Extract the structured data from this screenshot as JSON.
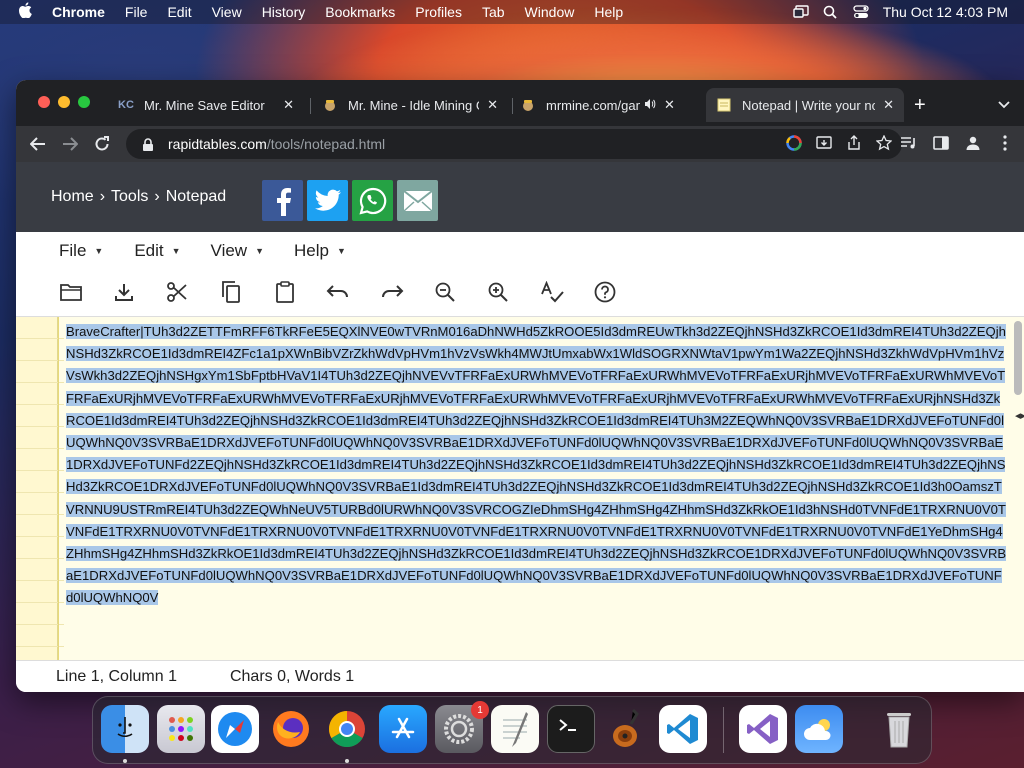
{
  "menubar": {
    "app_name": "Chrome",
    "items": [
      "File",
      "Edit",
      "View",
      "History",
      "Bookmarks",
      "Profiles",
      "Tab",
      "Window",
      "Help"
    ],
    "clock": "Thu Oct 12  4:03 PM"
  },
  "tabs": [
    {
      "title": "Mr. Mine Save Editor",
      "favicon": "KC"
    },
    {
      "title": "Mr. Mine - Idle Mining Game",
      "favicon": "miner"
    },
    {
      "title": "mrmine.com/game/",
      "favicon": "miner"
    },
    {
      "title": "Notepad | Write your notes",
      "favicon": "notepad"
    }
  ],
  "omnibox": {
    "domain": "rapidtables.com",
    "path": "/tools/notepad.html"
  },
  "site": {
    "breadcrumb": [
      "Home",
      "›",
      "Tools",
      "›",
      "Notepad"
    ],
    "share": [
      "f",
      "twitter",
      "whatsapp",
      "email"
    ]
  },
  "app_menu": [
    "File",
    "Edit",
    "View",
    "Help"
  ],
  "toolbar_icons": [
    "open-folder",
    "download",
    "cut",
    "copy",
    "paste",
    "undo",
    "redo",
    "zoom-out",
    "zoom-in",
    "spellcheck",
    "help"
  ],
  "editor": {
    "text": "BraveCrafter|TUh3d2ZETTFmRFF6TkRFeE5EQXlNVE0wTVRnM016aDhNWHd5ZkROOE5Id3dmREUwTkh3d2ZEQjhNSHd3ZkRCOE1Id3dmREI4TUh3d2ZEQjhNSHd3ZkRCOE1Id3dmREI4ZFc1a1pXWnBibVZrZkhWdVpHVm1hVzVsWkh4MWJtUmxabWx1WldSOGRXNWtaV1pwYm1Wa2ZEQjhNSHd3ZkhWdVpHVm1hVzVsWkh3d2ZEQjhNSHgxYm1SbFptbHVaV1I4TUh3d2ZEQjhNVEVvTFRFaExURWhMVEVoTFRFaExURWhMVEVoTFRFaExURjhMVEVoTFRFaExURWhMVEVoTFRFaExURjhMVEVoTFRFaExURWhMVEVoTFRFaExURjhMVEVoTFRFaExURWhMVEVoTFRFaExURjhMVEVoTFRFaExURWhMVEVoTFRFaExURjhNSHd3ZkRCOE1Id3dmREI4TUh3d2ZEQjhNSHd3ZkRCOE1Id3dmREI4TUh3d2ZEQjhNSHd3ZkRCOE1Id3dmREI4TUh3M2ZEQWhNQ0V3SVRBaE1DRXdJVEFoTUNFd0lUQWhNQ0V3SVRBaE1DRXdJVEFoTUNFd0lUQWhNQ0V3SVRBaE1DRXdJVEFoTUNFd0lUQWhNQ0V3SVRBaE1DRXdJVEFoTUNFd0lUQWhNQ0V3SVRBaE1DRXdJVEFoTUNFd2ZEQjhNSHd3ZkRCOE1Id3dmREI4TUh3d2ZEQjhNSHd3ZkRCOE1Id3dmREI4TUh3d2ZEQjhNSHd3ZkRCOE1Id3dmREI4TUh3d2ZEQjhNSHd3ZkRCOE1DRXdJVEFoTUNFd0lUQWhNQ0V3SVRBaE1Id3dmREI4TUh3d2ZEQjhNSHd3ZkRCOE1Id3dmREI4TUh3d2ZEQjhNSHd3ZkRCOE1Id3h0OamszTVRNNU9USTRmREI4TUh3d2ZEQWhNeUV5TURBd0lURWhNQ0V3SVRCOGZIeDhmSHg4ZHhmSHg4ZHhmSHd3ZkRkOE1Id3hNSHd0TVNFdE1TRXRNU0V0TVNFdE1TRXRNU0V0TVNFdE1TRXRNU0V0TVNFdE1TRXRNU0V0TVNFdE1TRXRNU0V0TVNFdE1TRXRNU0V0TVNFdE1TRXRNU0V0TVNFdE1YeDhmSHg4ZHhmSHg4ZHhmSHd3ZkRkOE1Id3dmREI4TUh3d2ZEQjhNSHd3ZkRCOE1Id3dmREI4TUh3d2ZEQjhNSHd3ZkRCOE1DRXdJVEFoTUNFd0lUQWhNQ0V3SVRBaE1DRXdJVEFoTUNFd0lUQWhNQ0V3SVRBaE1DRXdJVEFoTUNFd0lUQWhNQ0V3SVRBaE1DRXdJVEFoTUNFd0lUQWhNQ0V3SVRBaE1DRXdJVEFoTUNFd0lUQWhNQ0V"
  },
  "status": {
    "position": "Line 1, Column 1",
    "counts": "Chars 0, Words 1"
  },
  "dock": [
    "finder",
    "launchpad",
    "safari",
    "firefox",
    "chrome",
    "app-store",
    "system-settings",
    "textedit",
    "terminal",
    "garageband",
    "vscode",
    "visual-studio",
    "weather",
    "trash"
  ],
  "dock_badge": "1"
}
